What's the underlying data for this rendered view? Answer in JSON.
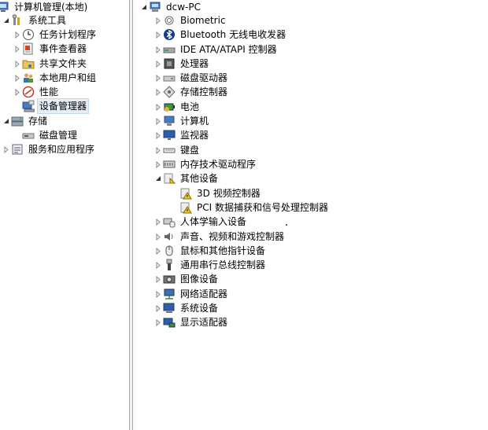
{
  "left_tree": {
    "root_label": "计算机管理(本地)",
    "system_tools": "系统工具",
    "task_scheduler": "任务计划程序",
    "event_viewer": "事件查看器",
    "shared_folders": "共享文件夹",
    "local_users": "本地用户和组",
    "performance": "性能",
    "device_manager": "设备管理器",
    "storage": "存储",
    "disk_management": "磁盘管理",
    "services_apps": "服务和应用程序"
  },
  "device_tree": {
    "computer_name": "dcw-PC",
    "categories": [
      "Biometric",
      "Bluetooth 无线电收发器",
      "IDE ATA/ATAPI 控制器",
      "处理器",
      "磁盘驱动器",
      "存储控制器",
      "电池",
      "计算机",
      "监视器",
      "键盘",
      "内存技术驱动程序",
      "其他设备",
      "人体学输入设备",
      "声音、视频和游戏控制器",
      "鼠标和其他指针设备",
      "通用串行总线控制器",
      "图像设备",
      "网络适配器",
      "系统设备",
      "显示适配器"
    ],
    "other_devices": [
      "3D 视频控制器",
      "PCI 数据捕获和信号处理控制器"
    ]
  }
}
